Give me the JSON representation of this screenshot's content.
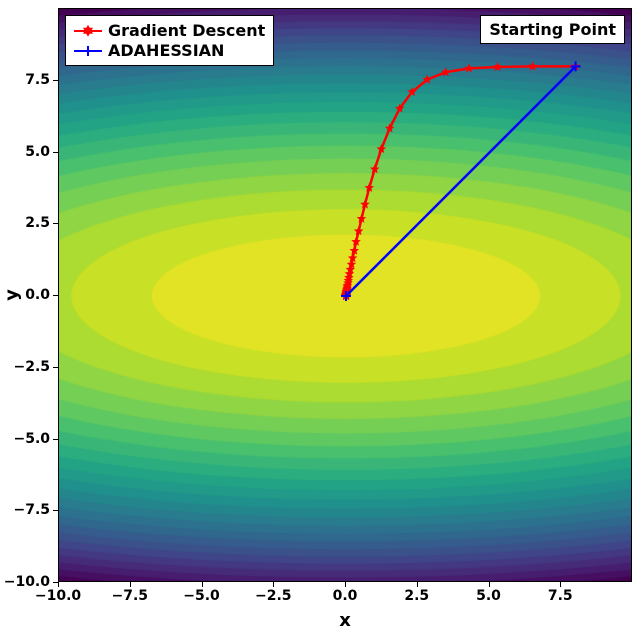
{
  "chart_data": {
    "type": "line",
    "title": "",
    "xlabel": "x",
    "ylabel": "y",
    "xlim": [
      -10,
      10
    ],
    "ylim": [
      -10,
      10
    ],
    "x_ticks": [
      -10.0,
      -7.5,
      -5.0,
      -2.5,
      0.0,
      2.5,
      5.0,
      7.5
    ],
    "y_ticks": [
      -10.0,
      -7.5,
      -5.0,
      -2.5,
      0.0,
      2.5,
      5.0,
      7.5
    ],
    "x_tick_labels": [
      "−10.0",
      "−7.5",
      "−5.0",
      "−2.5",
      "0.0",
      "2.5",
      "5.0",
      "7.5"
    ],
    "y_tick_labels": [
      "−10.0",
      "−7.5",
      "−5.0",
      "−2.5",
      "0.0",
      "2.5",
      "5.0",
      "7.5"
    ],
    "legend_position": "upper left",
    "annotation": {
      "text": "Starting Point",
      "xy": [
        8,
        8
      ]
    },
    "contour_function": "f(x,y) = x^2 + 10*y^2 (ill-conditioned quadratic)",
    "series": [
      {
        "name": "Gradient Descent",
        "color": "#ff0000",
        "marker": "star",
        "x": [
          8.0,
          6.5,
          5.28,
          4.29,
          3.48,
          2.83,
          2.3,
          1.87,
          1.52,
          1.23,
          1.0,
          0.81,
          0.66,
          0.54,
          0.44,
          0.35,
          0.29,
          0.23,
          0.19,
          0.15,
          0.12,
          0.1,
          0.08,
          0.07,
          0.05,
          0.04,
          0.04,
          0.03,
          0.02,
          0.02,
          0.02,
          0.01,
          0.01,
          0.01,
          0.01,
          0.01,
          0.0,
          0.0,
          0.0,
          0.0,
          0.0,
          0.0,
          0.0,
          0.0,
          0.0,
          0.0,
          0.0,
          0.0,
          0.0,
          0.0,
          0.0
        ],
        "y": [
          8.0,
          8.0,
          7.98,
          7.93,
          7.8,
          7.54,
          7.11,
          6.53,
          5.84,
          5.12,
          4.42,
          3.77,
          3.19,
          2.69,
          2.26,
          1.89,
          1.58,
          1.32,
          1.1,
          0.92,
          0.77,
          0.64,
          0.54,
          0.45,
          0.37,
          0.31,
          0.26,
          0.22,
          0.18,
          0.15,
          0.13,
          0.11,
          0.09,
          0.07,
          0.06,
          0.05,
          0.04,
          0.04,
          0.03,
          0.02,
          0.02,
          0.02,
          0.01,
          0.01,
          0.01,
          0.01,
          0.01,
          0.01,
          0.0,
          0.0,
          0.0
        ]
      },
      {
        "name": "ADAHESSIAN",
        "color": "#0000ff",
        "marker": "plus",
        "x": [
          8.0,
          0.0
        ],
        "y": [
          8.0,
          0.0
        ]
      }
    ]
  },
  "legend": {
    "entries": [
      {
        "label": "Gradient Descent",
        "color": "#ff0000"
      },
      {
        "label": "ADAHESSIAN",
        "color": "#0000ff"
      }
    ]
  }
}
